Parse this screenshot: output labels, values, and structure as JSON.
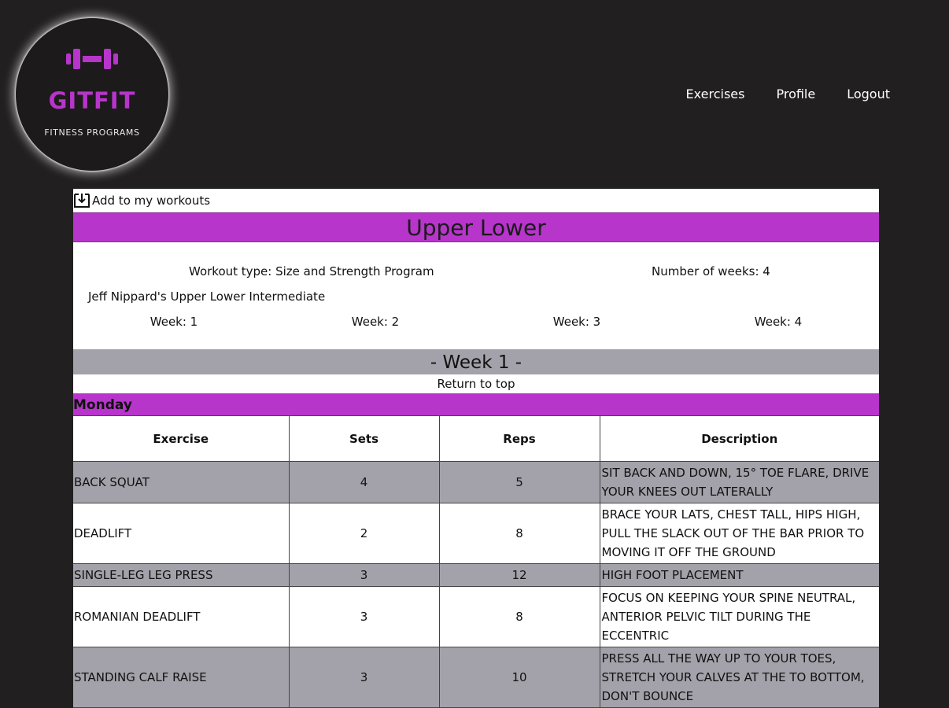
{
  "brand": {
    "name": "GITFIT",
    "subtitle": "FITNESS PROGRAMS",
    "accent": "#b735cb",
    "icon": "dumbbell-icon"
  },
  "nav": {
    "items": [
      {
        "label": "Exercises"
      },
      {
        "label": "Profile"
      },
      {
        "label": "Logout"
      }
    ]
  },
  "program": {
    "add_label": "Add to my workouts",
    "add_icon": "download-tray-icon",
    "title": "Upper Lower",
    "workout_type": "Workout type: Size and Strength Program",
    "number_of_weeks": "Number of weeks: 4",
    "description": "Jeff Nippard's Upper Lower Intermediate",
    "week_links": [
      "Week: 1",
      "Week: 2",
      "Week: 3",
      "Week: 4"
    ]
  },
  "week": {
    "header": "- Week 1 -",
    "return_top": "Return to top",
    "day": "Monday",
    "columns": [
      "Exercise",
      "Sets",
      "Reps",
      "Description"
    ],
    "rows": [
      {
        "exercise": "BACK SQUAT",
        "sets": "4",
        "reps": "5",
        "description": "SIT BACK AND DOWN, 15° TOE FLARE, DRIVE YOUR KNEES OUT LATERALLY"
      },
      {
        "exercise": "DEADLIFT",
        "sets": "2",
        "reps": "8",
        "description": "BRACE YOUR LATS, CHEST TALL, HIPS HIGH, PULL THE SLACK OUT OF THE BAR PRIOR TO MOVING IT OFF THE GROUND"
      },
      {
        "exercise": "SINGLE-LEG LEG PRESS",
        "sets": "3",
        "reps": "12",
        "description": "HIGH FOOT PLACEMENT"
      },
      {
        "exercise": "ROMANIAN DEADLIFT",
        "sets": "3",
        "reps": "8",
        "description": "FOCUS ON KEEPING YOUR SPINE NEUTRAL, ANTERIOR PELVIC TILT DURING THE ECCENTRIC"
      },
      {
        "exercise": "STANDING CALF RAISE",
        "sets": "3",
        "reps": "10",
        "description": "PRESS ALL THE WAY UP TO YOUR TOES, STRETCH YOUR CALVES AT THE TO BOTTOM, DON'T BOUNCE"
      }
    ]
  }
}
